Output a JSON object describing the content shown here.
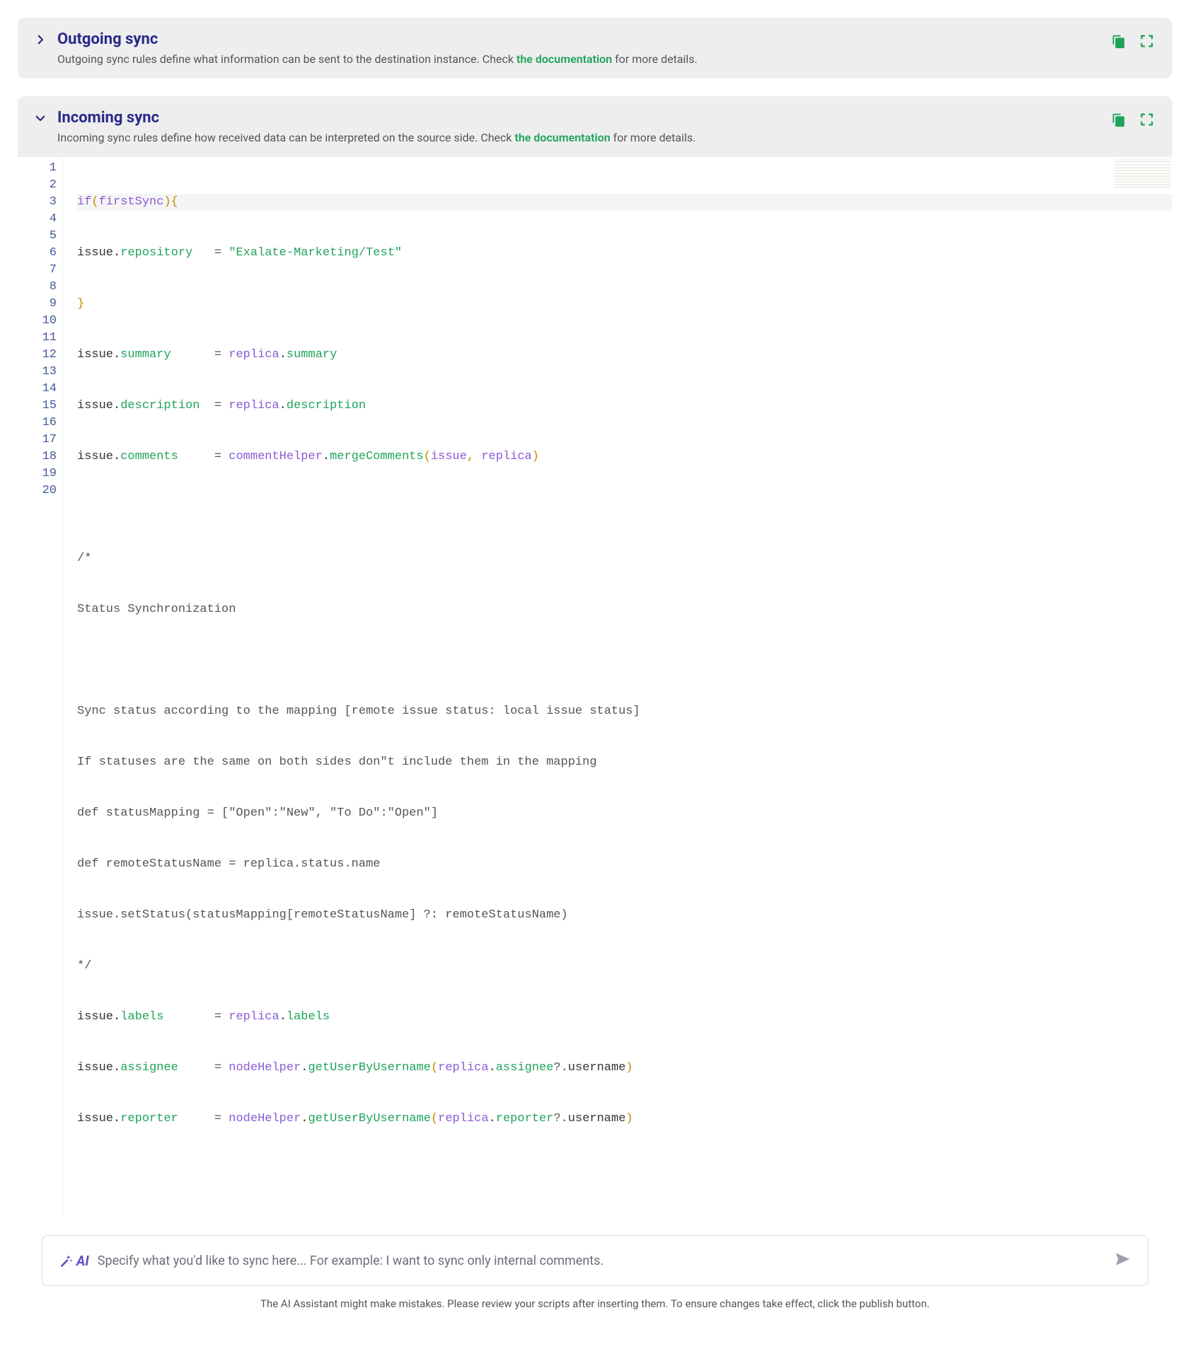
{
  "outgoing": {
    "title": "Outgoing sync",
    "desc_pre": "Outgoing sync rules define what information can be sent to the destination instance. Check ",
    "doc_link": "the documentation",
    "desc_post": " for more details."
  },
  "incoming": {
    "title": "Incoming sync",
    "desc_pre": "Incoming sync rules define how received data can be interpreted on the source side. Check ",
    "doc_link": "the documentation",
    "desc_post": " for more details."
  },
  "code": {
    "line_count": 20,
    "l1_if": "if",
    "l1_arg": "firstSync",
    "l2_obj": "issue",
    "l2_prop": "repository",
    "l2_eq": "=",
    "l2_str": "\"Exalate-Marketing/Test\"",
    "l3_close": "}",
    "l4_obj": "issue",
    "l4_prop": "summary",
    "l4_eq": "=",
    "l4_robj": "replica",
    "l4_rprop": "summary",
    "l5_obj": "issue",
    "l5_prop": "description",
    "l5_eq": "=",
    "l5_robj": "replica",
    "l5_rprop": "description",
    "l6_obj": "issue",
    "l6_prop": "comments",
    "l6_eq": "=",
    "l6_helper": "commentHelper",
    "l6_method": "mergeComments",
    "l6_arg1": "issue",
    "l6_sep": ", ",
    "l6_arg2": "replica",
    "l8_open": "/*",
    "l9_txt": "Status Synchronization",
    "l11_txt": "Sync status according to the mapping [remote issue status: local issue status]",
    "l12_txt": "If statuses are the same on both sides don\"t include them in the mapping",
    "l13_txt": "def statusMapping = [\"Open\":\"New\", \"To Do\":\"Open\"]",
    "l14_txt": "def remoteStatusName = replica.status.name",
    "l15_txt": "issue.setStatus(statusMapping[remoteStatusName] ?: remoteStatusName)",
    "l16_close": "*/",
    "l17_obj": "issue",
    "l17_prop": "labels",
    "l17_eq": "=",
    "l17_robj": "replica",
    "l17_rprop": "labels",
    "l18_obj": "issue",
    "l18_prop": "assignee",
    "l18_eq": "=",
    "l18_helper": "nodeHelper",
    "l18_method": "getUserByUsername",
    "l18_robj": "replica",
    "l18_rprop": "assignee",
    "l18_qdot": "?.",
    "l18_uname": "username",
    "l19_obj": "issue",
    "l19_prop": "reporter",
    "l19_eq": "=",
    "l19_helper": "nodeHelper",
    "l19_method": "getUserByUsername",
    "l19_robj": "replica",
    "l19_rprop": "reporter",
    "l19_qdot": "?.",
    "l19_uname": "username"
  },
  "ai": {
    "badge": "AI",
    "placeholder": "Specify what you'd like to sync here...  For example: I want to sync only internal comments.",
    "disclaimer": "The AI Assistant might make mistakes. Please review your scripts after inserting them. To ensure changes take effect, click the publish button."
  }
}
